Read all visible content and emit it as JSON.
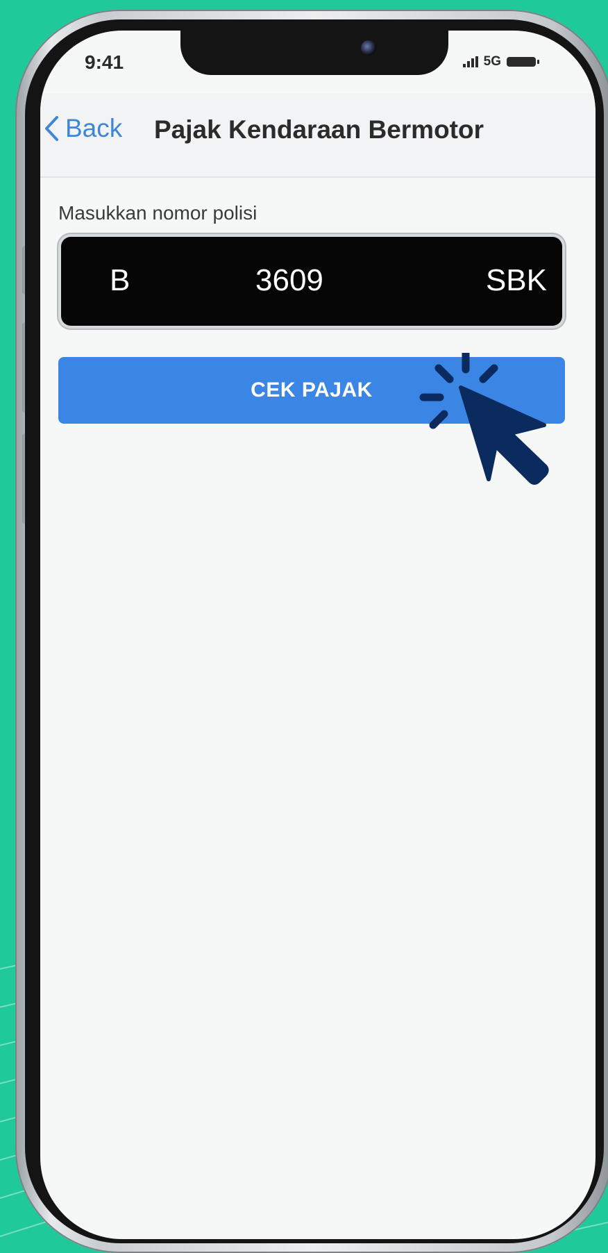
{
  "colors": {
    "background": "#1fc99a",
    "screen": "#f6f8f8",
    "accent": "#3b86e4",
    "back_link": "#3f86d6",
    "plate": "#050505",
    "cursor": "#0b2b5e"
  },
  "status_bar": {
    "time": "9:41",
    "network": "5G",
    "icons": [
      "signal-icon",
      "battery-icon"
    ]
  },
  "nav": {
    "back_label": "Back",
    "title": "Pajak Kendaraan Bermotor"
  },
  "form": {
    "label": "Masukkan nomor polisi",
    "plate": {
      "region": "B",
      "number": "3609",
      "suffix": "SBK"
    },
    "button_label": "CEK PAJAK"
  },
  "overlay": {
    "icon": "click-cursor-icon"
  }
}
